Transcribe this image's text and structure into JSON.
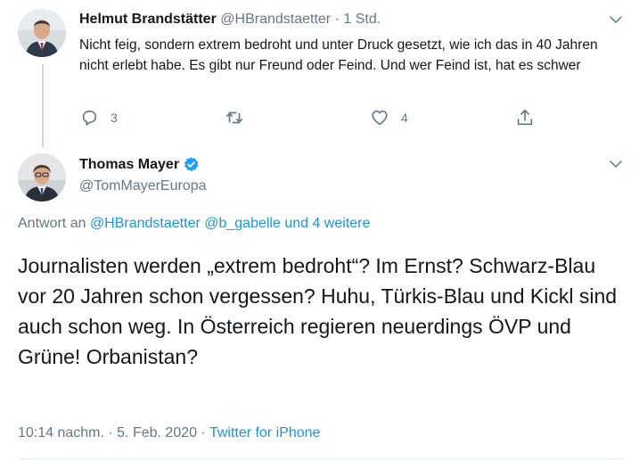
{
  "parent_tweet": {
    "author_name": "Helmut Brandstätter",
    "author_handle": "@HBrandstaetter",
    "separator": "·",
    "time": "1 Std.",
    "text": "Nicht feig, sondern extrem bedroht und unter Druck gesetzt, wie ich das in 40 Jahren nicht erlebt habe. Es gibt nur Freund oder Feind. Und wer Feind ist, hat es schwer",
    "actions": {
      "reply_count": "3",
      "retweet_count": "",
      "like_count": "4"
    }
  },
  "main_tweet": {
    "author_name": "Thomas Mayer",
    "author_handle": "@TomMayerEuropa",
    "verified": true,
    "reply_to": {
      "prefix": "Antwort an",
      "mentions": "@HBrandstaetter @b_gabelle und 4 weitere"
    },
    "text": "Journalisten werden „extrem bedroht“? Im Ernst? Schwarz-Blau vor 20 Jahren schon vergessen? Huhu, Türkis-Blau und Kickl sind auch schon weg. In Österreich regieren neuerdings ÖVP und Grüne! Orbanistan?",
    "timestamp": "10:14 nachm. · 5. Feb. 2020",
    "meta_separator": "·",
    "source": "Twitter for iPhone"
  },
  "icons": {
    "reply": "reply-icon",
    "retweet": "retweet-icon",
    "like": "like-icon",
    "share": "share-icon",
    "more": "chevron-down-icon",
    "verified": "verified-badge-icon"
  },
  "colors": {
    "text": "#14171a",
    "secondary": "#657786",
    "link": "#1b95e0",
    "verified": "#1da1f2",
    "border": "#e6ecf0"
  }
}
